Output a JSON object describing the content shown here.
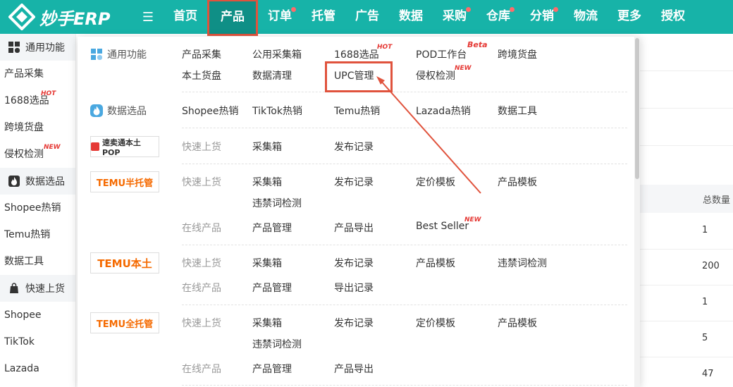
{
  "app": {
    "logo_text": "妙手ERP"
  },
  "colors": {
    "brand": "#17b3a8",
    "highlight": "#e0533d",
    "tag": "#e53935"
  },
  "nav": {
    "menu_icon": "hamburger-icon",
    "items": [
      {
        "label": "首页",
        "dot": false
      },
      {
        "label": "产品",
        "dot": false,
        "active": true
      },
      {
        "label": "订单",
        "dot": true
      },
      {
        "label": "托管",
        "dot": false
      },
      {
        "label": "广告",
        "dot": false
      },
      {
        "label": "数据",
        "dot": false
      },
      {
        "label": "采购",
        "dot": true
      },
      {
        "label": "仓库",
        "dot": true
      },
      {
        "label": "分销",
        "dot": true
      },
      {
        "label": "物流",
        "dot": false
      },
      {
        "label": "更多",
        "dot": false
      },
      {
        "label": "授权",
        "dot": false
      }
    ]
  },
  "sidebar": {
    "sections": [
      {
        "title": "通用功能",
        "icon": "grid-icon"
      },
      {
        "title": "数据选品",
        "icon": "flame-icon"
      },
      {
        "title": "快速上货",
        "icon": "bag-icon"
      }
    ],
    "items": [
      {
        "label": "产品采集"
      },
      {
        "label": "1688选品",
        "tag": "HOT"
      },
      {
        "label": "跨境货盘"
      },
      {
        "label": "侵权检测",
        "tag": "NEW"
      },
      {
        "label": "Shopee热销"
      },
      {
        "label": "Temu热销"
      },
      {
        "label": "数据工具"
      },
      {
        "label": "Shopee"
      },
      {
        "label": "TikTok"
      },
      {
        "label": "Lazada"
      }
    ]
  },
  "background_table": {
    "header": "总数量",
    "values": [
      "1",
      "200",
      "1",
      "5",
      "47"
    ]
  },
  "panel": {
    "general": {
      "title": "通用功能",
      "icon": "grid-icon",
      "row1": [
        "产品采集",
        "公用采集箱",
        "1688选品",
        "POD工作台",
        "跨境货盘"
      ],
      "row2": [
        "本土货盘",
        "数据清理",
        "UPC管理",
        "侵权检测"
      ],
      "tags": {
        "hot": "HOT",
        "beta": "Beta",
        "new": "NEW"
      }
    },
    "data": {
      "title": "数据选品",
      "icon": "flame-icon",
      "row": [
        "Shopee热销",
        "TikTok热销",
        "Temu热销",
        "Lazada热销",
        "数据工具"
      ]
    },
    "smt": {
      "brand": "速卖通本土POP",
      "row": [
        "快速上货",
        "采集箱",
        "发布记录"
      ]
    },
    "temu_semi": {
      "brand": "TEMU半托管",
      "row1": [
        "快速上货",
        "采集箱",
        "发布记录",
        "定价模板",
        "产品模板"
      ],
      "row1b": "违禁词检测",
      "row2": [
        "在线产品",
        "产品管理",
        "产品导出",
        "Best Seller"
      ],
      "tag": "NEW"
    },
    "temu_local": {
      "brand": "TEMU本土",
      "row1": [
        "快速上货",
        "采集箱",
        "发布记录",
        "产品模板",
        "违禁词检测"
      ],
      "row2": [
        "在线产品",
        "产品管理",
        "导出记录"
      ]
    },
    "temu_full": {
      "brand": "TEMU全托管",
      "row1": [
        "快速上货",
        "采集箱",
        "发布记录",
        "定价模板",
        "产品模板"
      ],
      "row1b": "违禁词检测",
      "row2": [
        "在线产品",
        "产品管理",
        "产品导出"
      ]
    }
  }
}
